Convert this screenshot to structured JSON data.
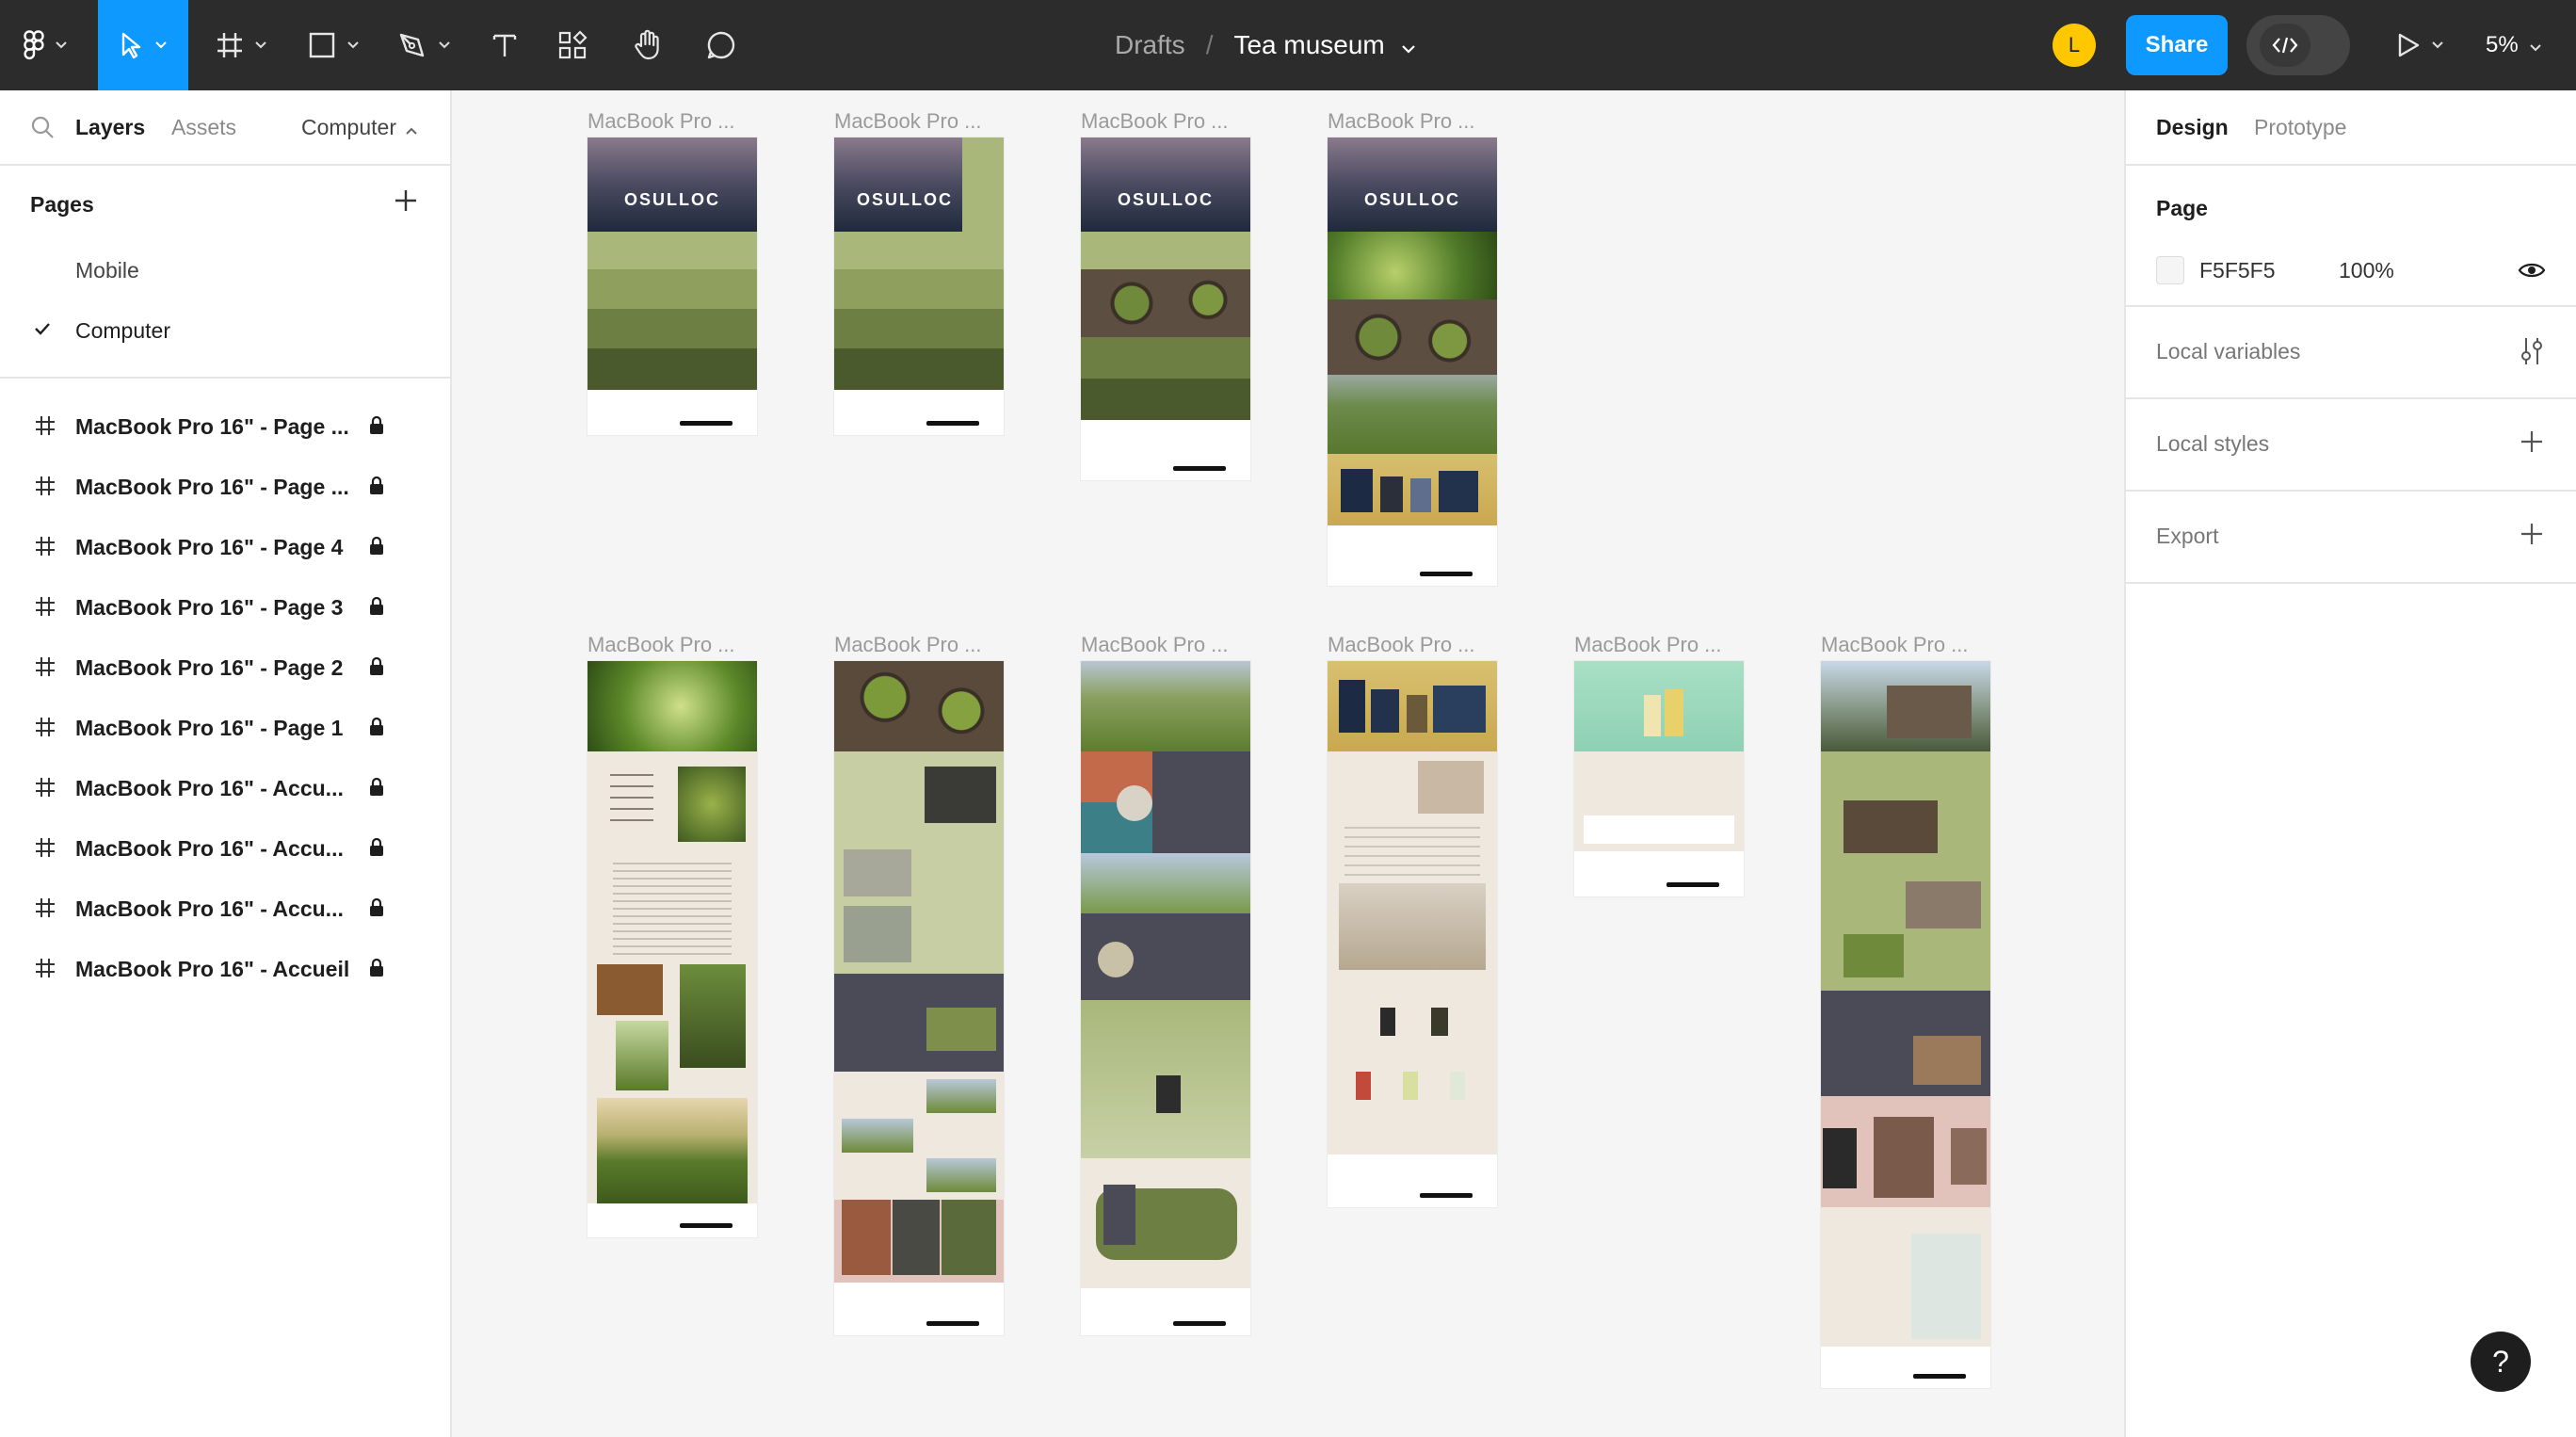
{
  "toolbar": {
    "breadcrumb_drafts": "Drafts",
    "breadcrumb_separator": "/",
    "file_name": "Tea museum",
    "avatar_initial": "L",
    "share_label": "Share",
    "zoom_label": "5%"
  },
  "left_panel": {
    "tabs": [
      "Layers",
      "Assets"
    ],
    "current_page_select": "Computer",
    "pages_title": "Pages",
    "pages": [
      {
        "label": "Mobile",
        "selected": false
      },
      {
        "label": "Computer",
        "selected": true
      }
    ],
    "layers": [
      "MacBook Pro 16\" - Page ...",
      "MacBook Pro 16\" - Page ...",
      "MacBook Pro 16\" - Page 4",
      "MacBook Pro 16\" - Page 3",
      "MacBook Pro 16\" - Page 2",
      "MacBook Pro 16\" - Page 1",
      "MacBook Pro 16\" - Accu...",
      "MacBook Pro 16\" - Accu...",
      "MacBook Pro 16\" - Accu...",
      "MacBook Pro 16\" - Accueil"
    ]
  },
  "right_panel": {
    "tabs": [
      "Design",
      "Prototype"
    ],
    "page_title": "Page",
    "page_color_hex": "F5F5F5",
    "page_color_opacity": "100%",
    "sections": [
      "Local variables",
      "Local styles",
      "Export"
    ]
  },
  "canvas": {
    "frame_label": "MacBook Pro ...",
    "brand_text": "OSULLOC"
  },
  "help_label": "?",
  "colors": {
    "toolbar_bg": "#2c2c2c",
    "accent": "#0d99ff",
    "canvas_bg": "#f5f5f5",
    "tea_green": "#8fa05e",
    "dark_green": "#4a5a2c",
    "slate": "#4b4b58",
    "beige": "#efe8de",
    "pink": "#e2c3bb"
  }
}
